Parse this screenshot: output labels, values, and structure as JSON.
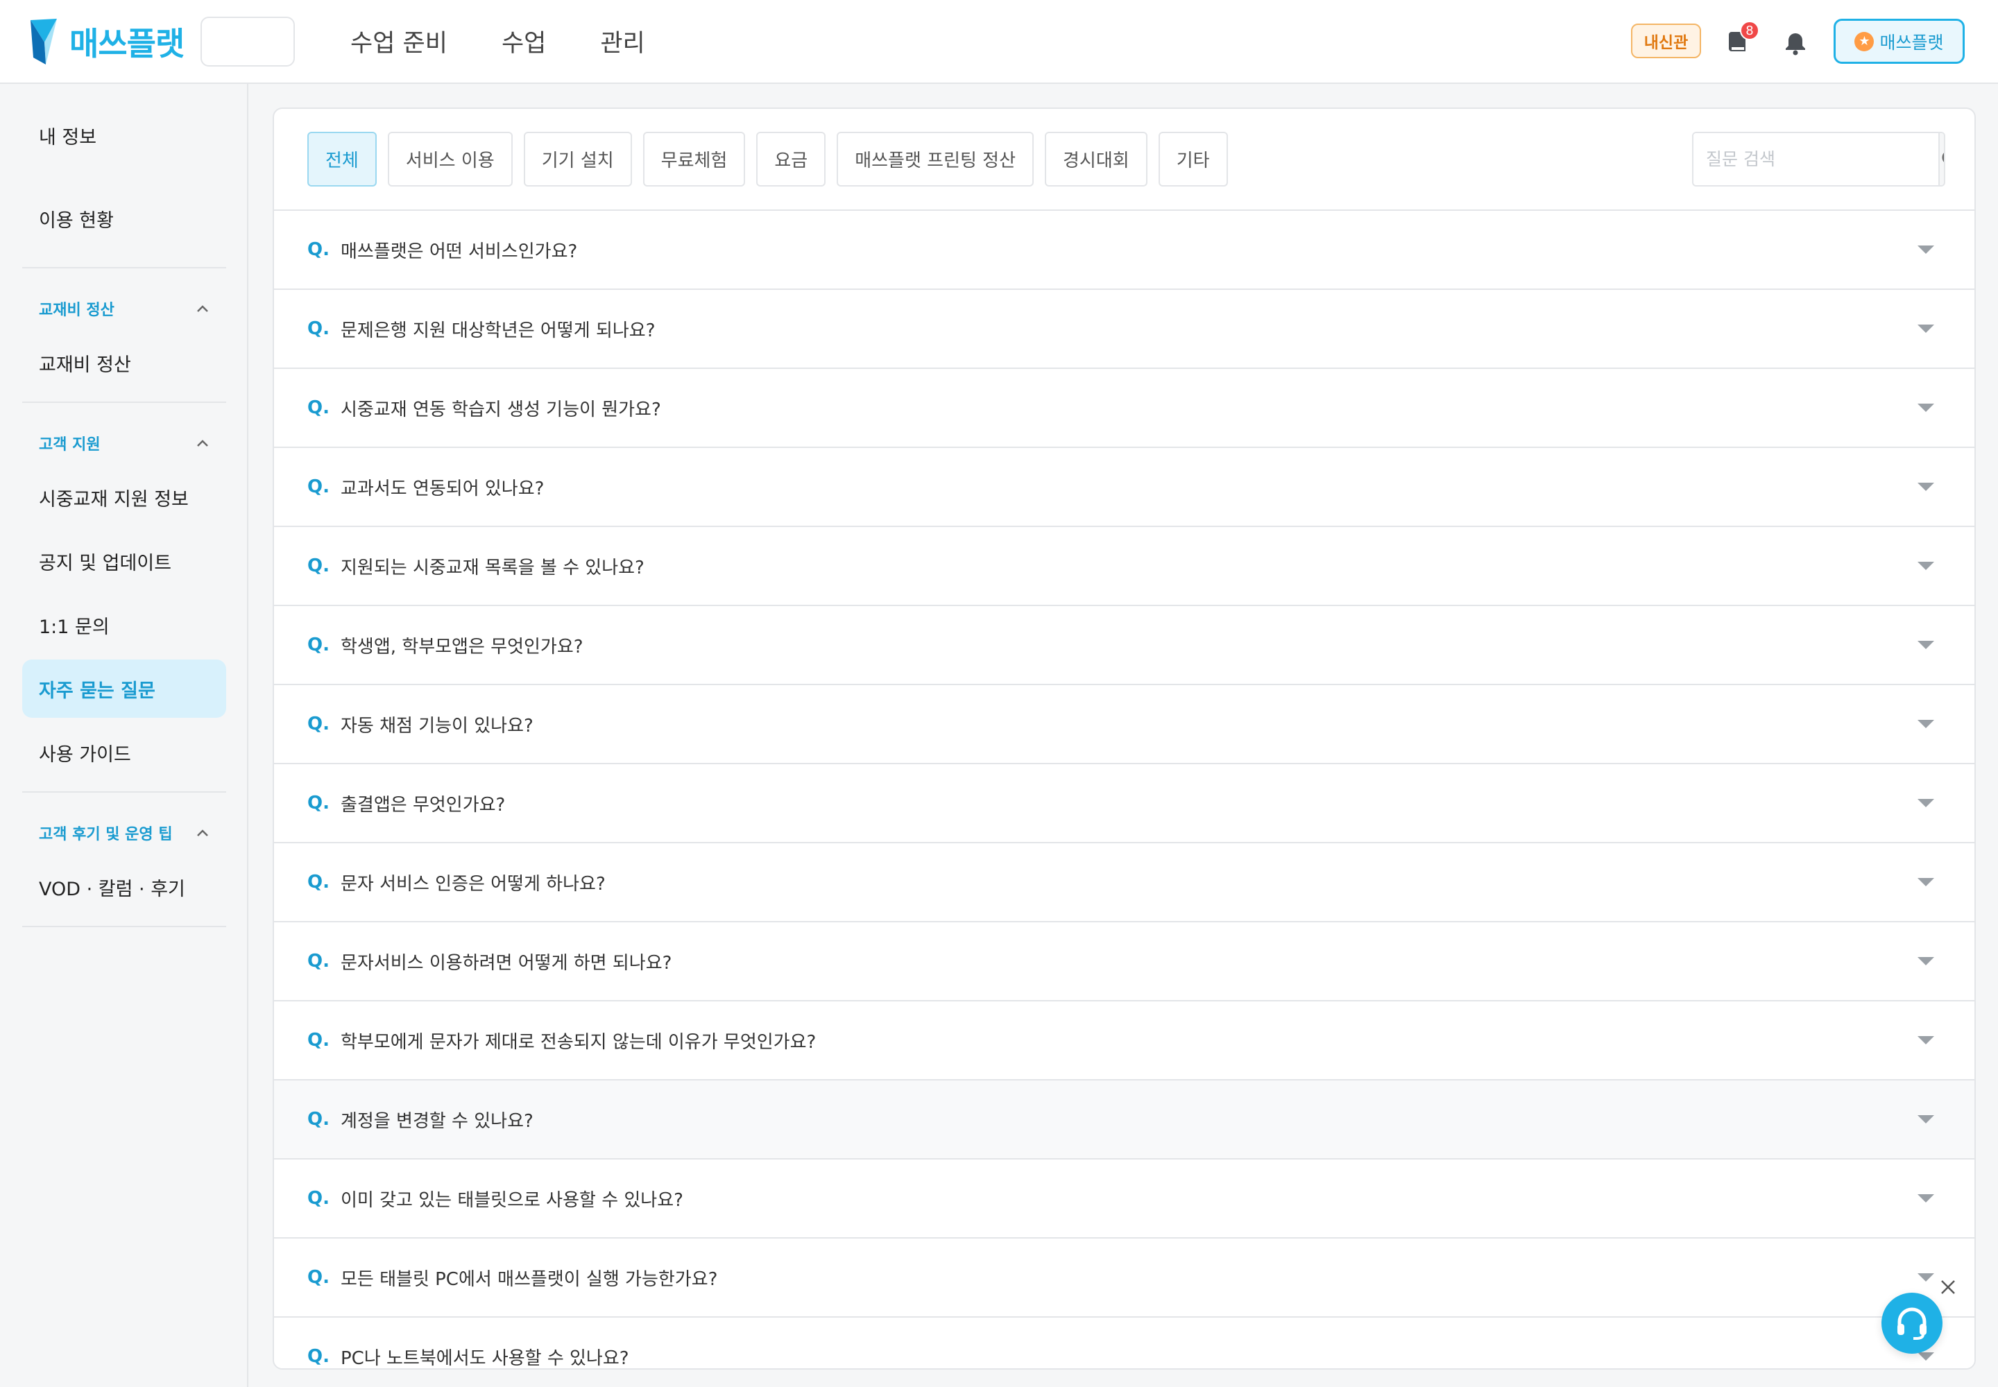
{
  "brand": {
    "name": "매쓰플랫",
    "accent": "#1fb1e6",
    "org_placeholder": ""
  },
  "nav": {
    "items": [
      "수업 준비",
      "수업",
      "관리"
    ]
  },
  "header": {
    "naesin_label": "내신관",
    "book_badge_count": "8",
    "profile_label": "매쓰플랫"
  },
  "sidebar": {
    "my_info": "내 정보",
    "usage": "이용 현황",
    "section_settlement": {
      "title": "교재비 정산",
      "items": [
        "교재비 정산"
      ]
    },
    "section_support": {
      "title": "고객 지원",
      "items": [
        "시중교재 지원 정보",
        "공지 및 업데이트",
        "1:1 문의",
        "자주 묻는 질문",
        "사용 가이드"
      ],
      "active": "자주 묻는 질문"
    },
    "section_reviews": {
      "title": "고객 후기 및 운영 팁",
      "items": [
        "VOD · 칼럼 · 후기"
      ]
    }
  },
  "filters": [
    "전체",
    "서비스 이용",
    "기기 설치",
    "무료체험",
    "요금",
    "매쓰플랫 프린팅 정산",
    "경시대회",
    "기타"
  ],
  "active_filter": "전체",
  "search": {
    "placeholder": "질문 검색",
    "value": ""
  },
  "faq": {
    "q_prefix": "Q.",
    "items": [
      "매쓰플랫은 어떤 서비스인가요?",
      "문제은행 지원 대상학년은 어떻게 되나요?",
      "시중교재 연동 학습지 생성 기능이 뭔가요?",
      "교과서도 연동되어 있나요?",
      "지원되는 시중교재 목록을 볼 수 있나요?",
      "학생앱, 학부모앱은 무엇인가요?",
      "자동 채점 기능이 있나요?",
      "출결앱은 무엇인가요?",
      "문자 서비스 인증은 어떻게 하나요?",
      "문자서비스 이용하려면 어떻게 하면 되나요?",
      "학부모에게 문자가 제대로 전송되지 않는데 이유가 무엇인가요?",
      "계정을 변경할 수 있나요?",
      "이미 갖고 있는 태블릿으로 사용할 수 있나요?",
      "모든 태블릿 PC에서 매쓰플랫이 실행 가능한가요?",
      "PC나 노트북에서도 사용할 수 있나요?"
    ],
    "hovered_index": 11
  }
}
